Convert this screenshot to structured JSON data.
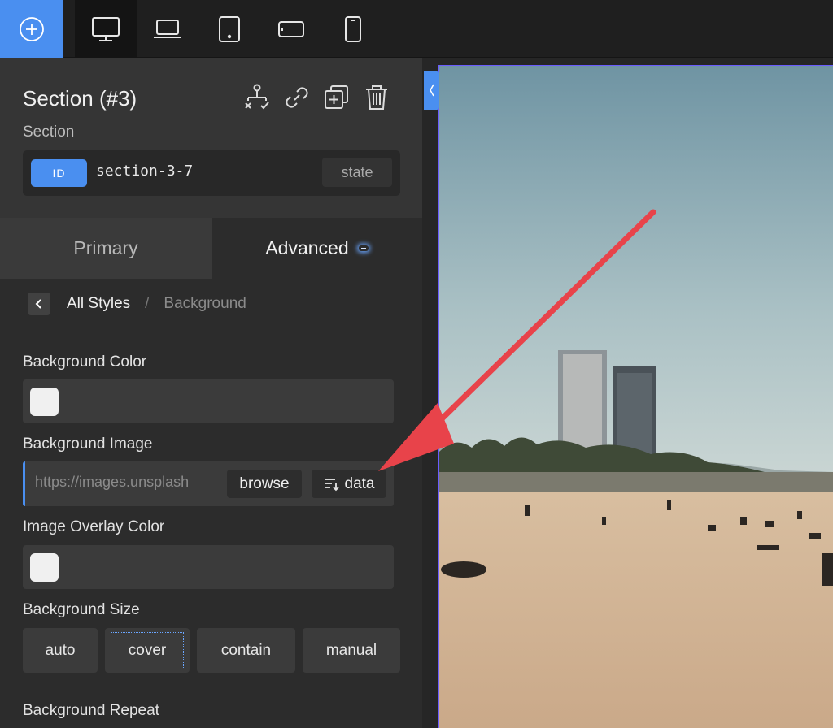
{
  "toolbar": {
    "add_icon": "plus-circle-icon",
    "devices": [
      {
        "name": "desktop",
        "icon": "desktop-icon",
        "active": true
      },
      {
        "name": "laptop",
        "icon": "laptop-icon",
        "active": false
      },
      {
        "name": "tablet",
        "icon": "tablet-icon",
        "active": false
      },
      {
        "name": "tablet-landscape",
        "icon": "tablet-landscape-icon",
        "active": false
      },
      {
        "name": "phone",
        "icon": "phone-icon",
        "active": false
      }
    ]
  },
  "panel": {
    "title": "Section (#3)",
    "subtitle": "Section",
    "actions": [
      "structure-icon",
      "link-icon",
      "duplicate-icon",
      "trash-icon"
    ],
    "id_badge": "ID",
    "id_value": "section-3-7",
    "state_label": "state",
    "tabs": {
      "primary": "Primary",
      "advanced": "Advanced"
    },
    "breadcrumb": {
      "parent": "All Styles",
      "separator": "/",
      "current": "Background"
    },
    "background_color": {
      "label": "Background Color",
      "swatch": "#f0f0f0"
    },
    "background_image": {
      "label": "Background Image",
      "placeholder": "https://images.unsplash",
      "browse_label": "browse",
      "data_label": "data"
    },
    "overlay_color": {
      "label": "Image Overlay Color",
      "swatch": "#f0f0f0"
    },
    "background_size": {
      "label": "Background Size",
      "options": [
        "auto",
        "cover",
        "contain",
        "manual"
      ],
      "selected": "cover"
    },
    "background_repeat": {
      "label": "Background Repeat"
    }
  },
  "colors": {
    "accent": "#4a8ff0",
    "arrow": "#e8434a",
    "guide": "#6a5cff"
  }
}
